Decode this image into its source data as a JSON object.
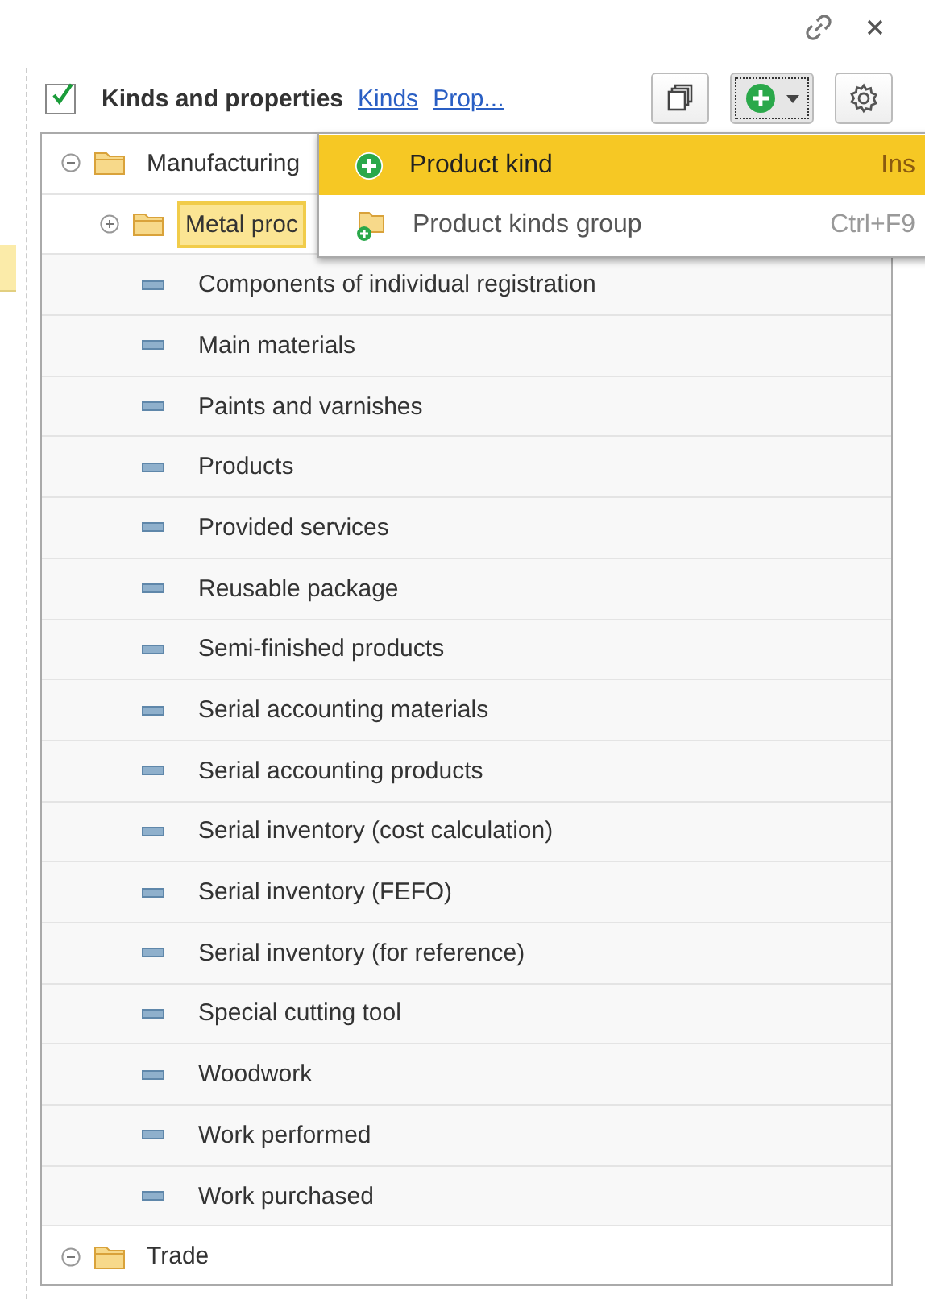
{
  "header": {
    "checked": true,
    "title": "Kinds and properties",
    "links": [
      "Kinds",
      "Prop..."
    ]
  },
  "menu": [
    {
      "kind": "add",
      "label": "Product kind",
      "shortcut": "Ins",
      "selected": true
    },
    {
      "kind": "add-group",
      "label": "Product kinds group",
      "shortcut": "Ctrl+F9",
      "selected": false
    }
  ],
  "tree": [
    {
      "kind": "group",
      "label": "Manufacturing",
      "expanded": true,
      "selected": false,
      "children": [
        {
          "kind": "group",
          "label": "Metal proc",
          "expanded": false,
          "selected": true
        },
        {
          "kind": "item",
          "label": "Components of individual registration",
          "selected": false
        },
        {
          "kind": "item",
          "label": "Main materials",
          "selected": false
        },
        {
          "kind": "item",
          "label": "Paints and varnishes",
          "selected": false
        },
        {
          "kind": "item",
          "label": "Products",
          "selected": false
        },
        {
          "kind": "item",
          "label": "Provided services",
          "selected": false
        },
        {
          "kind": "item",
          "label": "Reusable package",
          "selected": false
        },
        {
          "kind": "item",
          "label": "Semi-finished products",
          "selected": false
        },
        {
          "kind": "item",
          "label": "Serial accounting materials",
          "selected": false
        },
        {
          "kind": "item",
          "label": "Serial accounting products",
          "selected": false
        },
        {
          "kind": "item",
          "label": "Serial inventory (cost calculation)",
          "selected": false
        },
        {
          "kind": "item",
          "label": "Serial inventory (FEFO)",
          "selected": false
        },
        {
          "kind": "item",
          "label": "Serial inventory (for reference)",
          "selected": false
        },
        {
          "kind": "item",
          "label": "Special cutting tool",
          "selected": false
        },
        {
          "kind": "item",
          "label": "Woodwork",
          "selected": false
        },
        {
          "kind": "item",
          "label": "Work performed",
          "selected": false
        },
        {
          "kind": "item",
          "label": "Work purchased",
          "selected": false
        }
      ]
    },
    {
      "kind": "group",
      "label": "Trade",
      "expanded": true,
      "selected": false
    }
  ]
}
